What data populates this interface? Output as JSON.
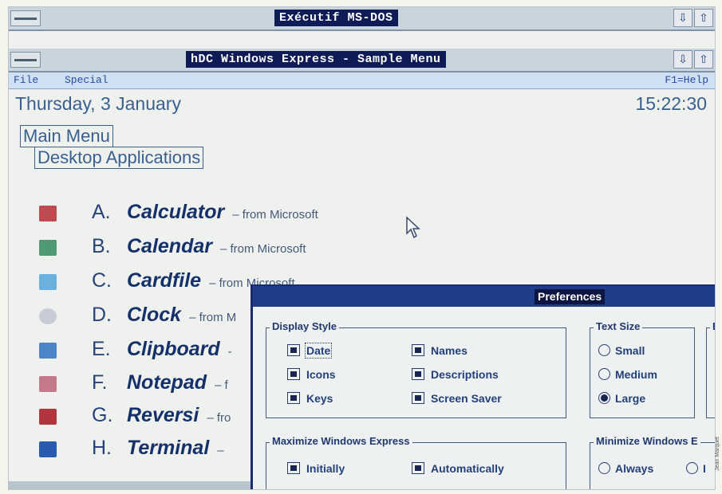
{
  "outer_window": {
    "title": "Exécutif MS-DOS",
    "arrow_down": "⇩",
    "arrow_up": "⇧"
  },
  "app_window": {
    "title": "hDC Windows Express - Sample Menu",
    "arrow_down": "⇩",
    "arrow_up": "⇧"
  },
  "menubar": {
    "file": "File",
    "special": "Special",
    "help": "F1=Help"
  },
  "status": {
    "date": "Thursday, 3 January",
    "time": "15:22:30"
  },
  "menus": {
    "main": "Main Menu",
    "sub": "Desktop Applications"
  },
  "apps": [
    {
      "letter": "A.",
      "name": "Calculator",
      "source": "– from Microsoft",
      "icon": "calculator-icon",
      "color": "#c04a52"
    },
    {
      "letter": "B.",
      "name": "Calendar",
      "source": "– from Microsoft",
      "icon": "calendar-icon",
      "color": "#4f9a74"
    },
    {
      "letter": "C.",
      "name": "Cardfile",
      "source": "– from Microsoft",
      "icon": "cardfile-icon",
      "color": "#6bb0de"
    },
    {
      "letter": "D.",
      "name": "Clock",
      "source": "– from M",
      "icon": "clock-icon",
      "color": "#c8ccd6"
    },
    {
      "letter": "E.",
      "name": "Clipboard",
      "source": "-",
      "icon": "clipboard-icon",
      "color": "#4a86c8"
    },
    {
      "letter": "F.",
      "name": "Notepad",
      "source": "– f",
      "icon": "notepad-icon",
      "color": "#c47a88"
    },
    {
      "letter": "G.",
      "name": "Reversi",
      "source": "– fro",
      "icon": "reversi-icon",
      "color": "#b2343e"
    },
    {
      "letter": "H.",
      "name": "Terminal",
      "source": "–",
      "icon": "terminal-icon",
      "color": "#2a5ab0"
    }
  ],
  "dialog": {
    "title": "Preferences",
    "display_style": {
      "label": "Display Style",
      "options": [
        "Date",
        "Icons",
        "Keys",
        "Names",
        "Descriptions",
        "Screen Saver"
      ]
    },
    "text_size": {
      "label": "Text Size",
      "options": [
        "Small",
        "Medium",
        "Large"
      ],
      "selected": "Large"
    },
    "maximize": {
      "label": "Maximize Windows Express",
      "options": [
        "Initially",
        "Automatically"
      ]
    },
    "minimize": {
      "label": "Minimize Windows E",
      "options": [
        "Always",
        "I"
      ]
    },
    "cut_group_label": "E"
  },
  "credit": "Jean Marquet"
}
